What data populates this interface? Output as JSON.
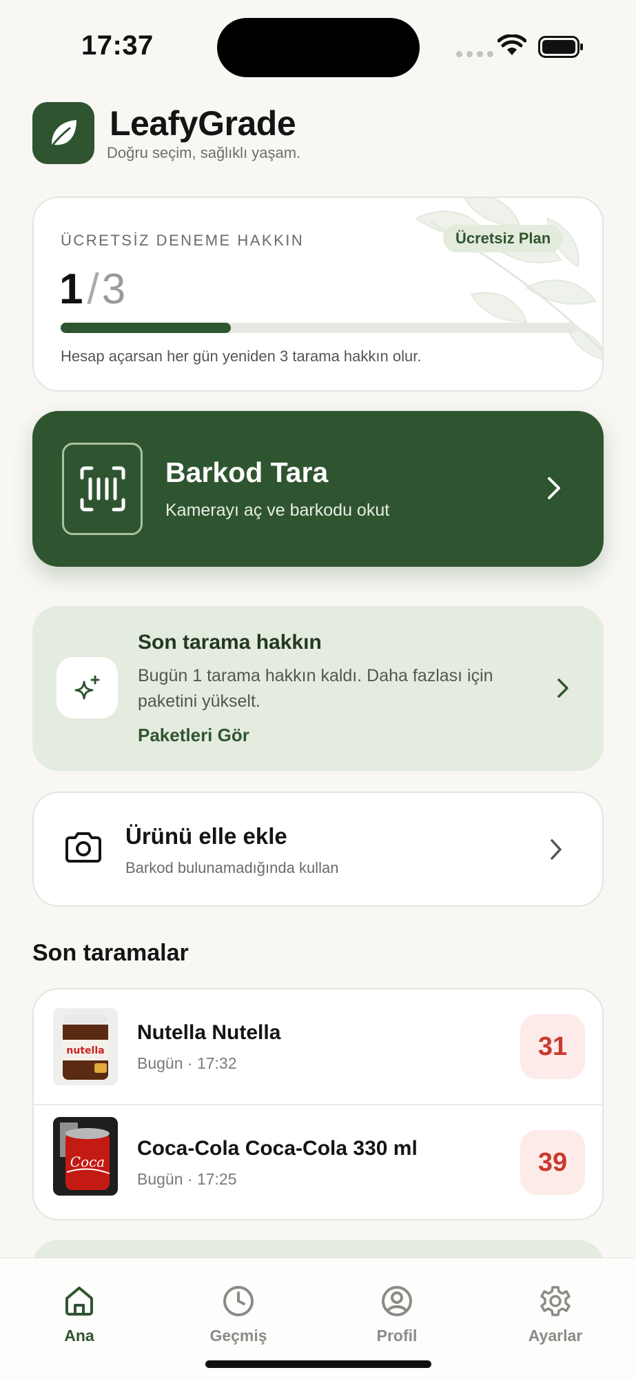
{
  "status_bar": {
    "time": "17:37"
  },
  "header": {
    "title": "LeafyGrade",
    "subtitle": "Doğru seçim, sağlıklı yaşam."
  },
  "trial": {
    "label": "ÜCRETSİZ DENEME HAKKIN",
    "plan_badge": "Ücretsiz Plan",
    "used": "1",
    "slash": "/",
    "total": "3",
    "progress": 0.33,
    "note": "Hesap açarsan her gün yeniden 3 tarama hakkın olur."
  },
  "scan": {
    "title": "Barkod Tara",
    "subtitle": "Kamerayı aç ve barkodu okut"
  },
  "upgrade": {
    "title": "Son tarama hakkın",
    "text": "Bugün 1 tarama hakkın kaldı. Daha fazlası için paketini yükselt.",
    "link": "Paketleri Gör"
  },
  "manual": {
    "title": "Ürünü elle ekle",
    "subtitle": "Barkod bulunamadığında kullan"
  },
  "recent": {
    "title": "Son taramalar",
    "items": [
      {
        "name": "Nutella Nutella",
        "time": "Bugün · 17:32",
        "score": "31",
        "thumb_text": "nutella"
      },
      {
        "name": "Coca-Cola Coca-Cola 330 ml",
        "time": "Bugün · 17:25",
        "score": "39",
        "thumb_text": "Coca"
      }
    ]
  },
  "tabs": [
    {
      "label": "Ana",
      "icon": "home-icon",
      "active": true
    },
    {
      "label": "Geçmiş",
      "icon": "clock-icon",
      "active": false
    },
    {
      "label": "Profil",
      "icon": "profile-icon",
      "active": false
    },
    {
      "label": "Ayarlar",
      "icon": "gear-icon",
      "active": false
    }
  ],
  "colors": {
    "brand": "#2f5530",
    "score_bad": "#c93a2e",
    "score_bg": "#fdebea",
    "soft_green": "#e4ebdf"
  }
}
